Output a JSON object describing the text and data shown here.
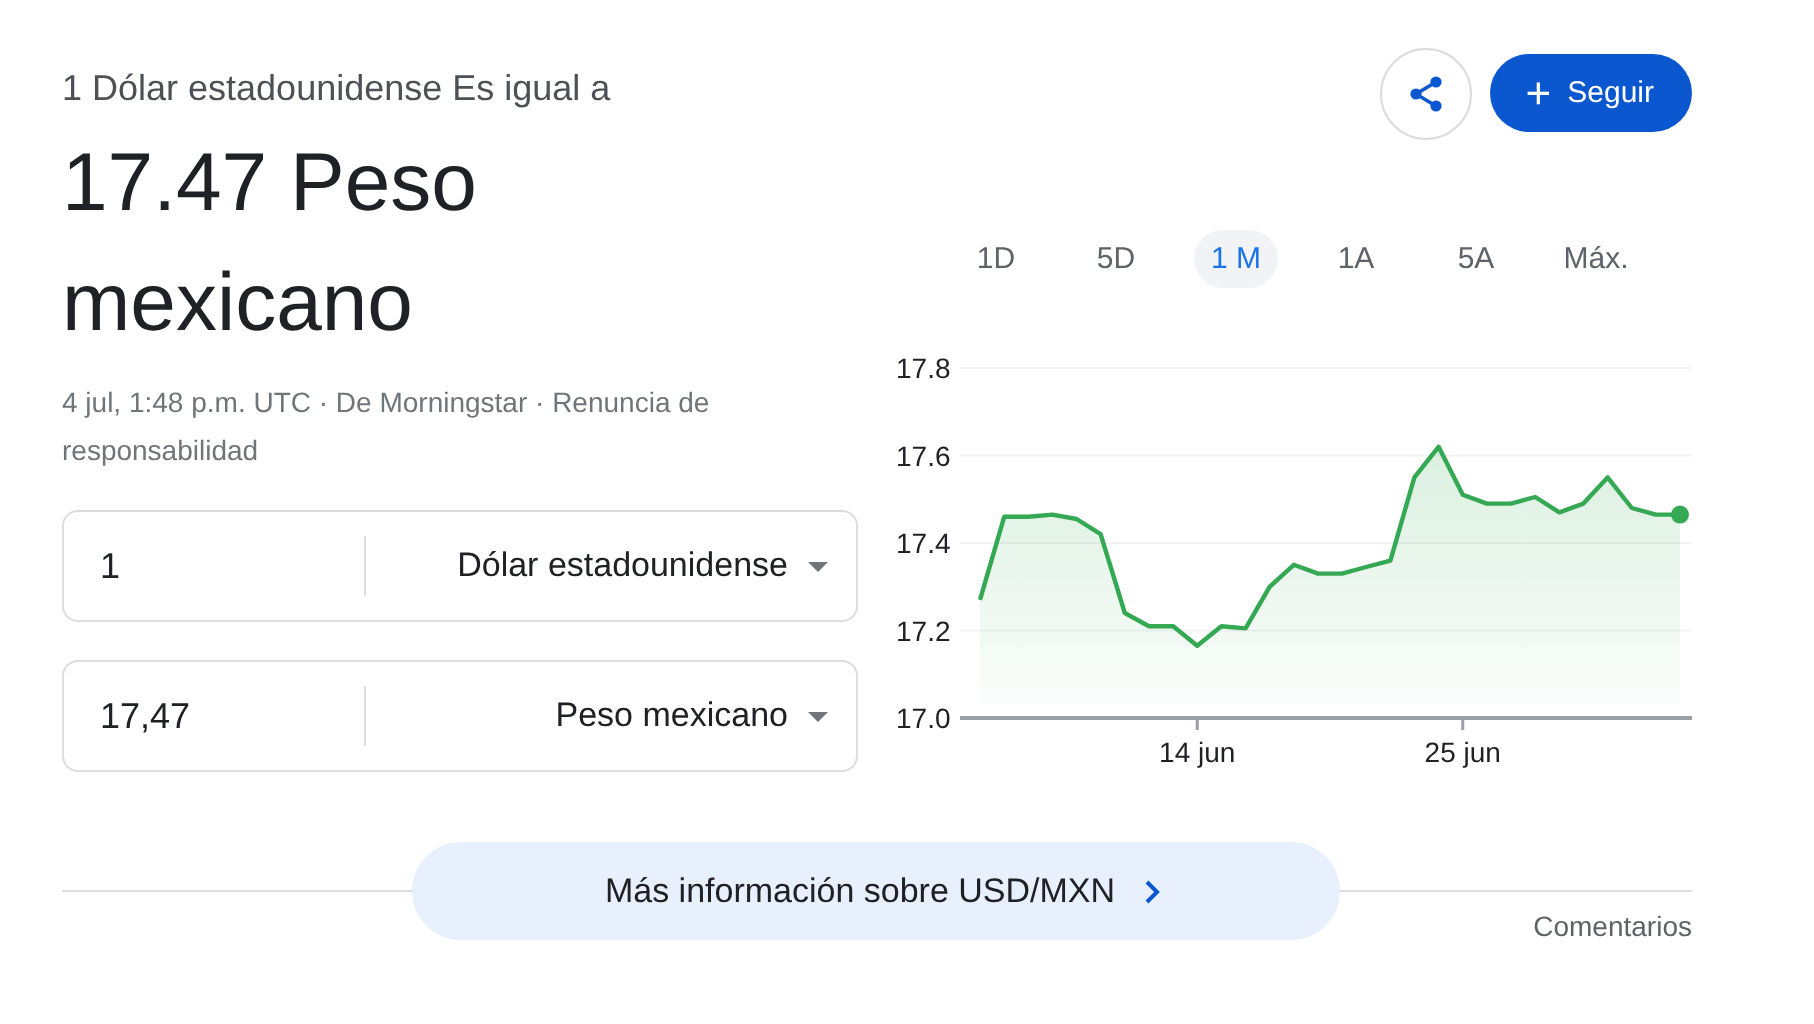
{
  "header": {
    "subtitle": "1 Dólar estadounidense Es igual a",
    "result_lines": [
      "17.47 Peso",
      "mexicano"
    ],
    "meta": "4 jul, 1:48 p.m. UTC · De Morningstar · Renuncia de responsabilidad"
  },
  "actions": {
    "follow_label": "+",
    "follow_text": "Seguir"
  },
  "converters": [
    {
      "amount": "1",
      "currency": "Dólar estadounidense"
    },
    {
      "amount": "17,47",
      "currency": "Peso mexicano"
    }
  ],
  "ranges": [
    {
      "label": "1D",
      "selected": false
    },
    {
      "label": "5D",
      "selected": false
    },
    {
      "label": "1 M",
      "selected": true
    },
    {
      "label": "1A",
      "selected": false
    },
    {
      "label": "5A",
      "selected": false
    },
    {
      "label": "Máx.",
      "selected": false
    }
  ],
  "chart_data": {
    "type": "area",
    "categories": [
      null,
      null,
      null,
      null,
      null,
      null,
      null,
      null,
      null,
      "14 jun",
      null,
      null,
      null,
      null,
      null,
      null,
      null,
      null,
      null,
      null,
      "25 jun",
      null,
      null,
      null,
      null,
      null,
      null,
      null,
      null,
      null
    ],
    "series": [
      {
        "color": "#34a853",
        "values": [
          17.27,
          17.46,
          17.46,
          17.465,
          17.455,
          17.42,
          17.24,
          17.21,
          17.21,
          17.165,
          17.21,
          17.205,
          17.3,
          17.35,
          17.33,
          17.33,
          17.345,
          17.36,
          17.55,
          17.62,
          17.51,
          17.49,
          17.49,
          17.505,
          17.47,
          17.49,
          17.55,
          17.48,
          17.465,
          17.465
        ]
      }
    ],
    "ylim": [
      17.0,
      17.8
    ],
    "yticks": [
      {
        "value": 17.8,
        "label": "17.8"
      },
      {
        "value": 17.6,
        "label": "17.6"
      },
      {
        "value": 17.4,
        "label": "17.4"
      },
      {
        "value": 17.2,
        "label": "17.2"
      },
      {
        "value": 17.0,
        "label": "17.0"
      }
    ],
    "grid": true
  },
  "more_info": {
    "text": "Más información sobre USD/MXN"
  },
  "feedback": "Comentarios"
}
